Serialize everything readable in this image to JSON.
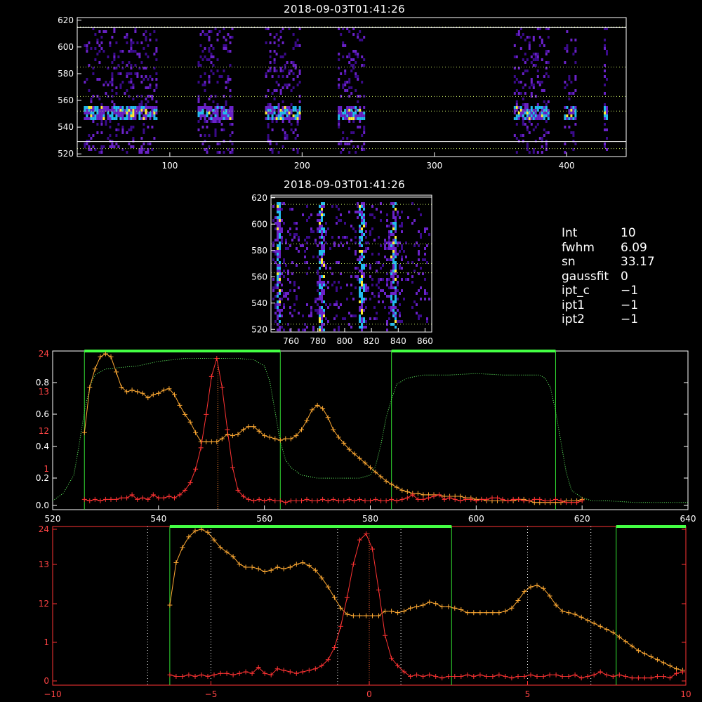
{
  "chart_data": [
    {
      "type": "heatmap",
      "title": "2018-09-03T01:41:26",
      "xlim": [
        30,
        445
      ],
      "ylim": [
        518,
        622
      ],
      "x_ticks": [
        "100",
        "200",
        "300",
        "400"
      ],
      "y_ticks": [
        "520",
        "540",
        "560",
        "580",
        "600",
        "620"
      ],
      "bands_x": [
        [
          35,
          90
        ],
        [
          121,
          148
        ],
        [
          172,
          198
        ],
        [
          227,
          247
        ],
        [
          360,
          386
        ],
        [
          398,
          406
        ],
        [
          428,
          431
        ]
      ],
      "core_y": 551,
      "guide_lines_y": [
        524,
        552,
        563,
        585,
        615
      ],
      "colors": {
        "low": "#3a0a8a",
        "mid": "#6a22c8",
        "high": "#22bbee",
        "peak": "#ffee33"
      }
    },
    {
      "type": "heatmap",
      "title": "2018-09-03T01:41:26",
      "xlim": [
        745,
        865
      ],
      "ylim": [
        518,
        622
      ],
      "x_ticks": [
        "760",
        "780",
        "800",
        "820",
        "840",
        "860"
      ],
      "y_ticks": [
        "520",
        "540",
        "560",
        "580",
        "600",
        "620"
      ],
      "streaks_x": [
        750,
        782,
        812,
        836
      ],
      "guide_lines_y": [
        524,
        563,
        570,
        585,
        615
      ]
    },
    {
      "type": "line",
      "xlim": [
        520,
        640
      ],
      "x_ticks": [
        "520",
        "540",
        "560",
        "580",
        "600",
        "620",
        "640"
      ],
      "left_ticks_white": [
        "0.0",
        "0.2",
        "0.4",
        "0.6",
        "0.8"
      ],
      "left_ticks_red": [
        "1",
        "12",
        "13",
        "24"
      ],
      "filter_windows": [
        [
          526,
          563
        ],
        [
          584,
          615
        ]
      ],
      "series": [
        {
          "color": "#ffaa33",
          "x": [
            526,
            527,
            528,
            529,
            530,
            531,
            532,
            533,
            534,
            535,
            536,
            537,
            538,
            539,
            540,
            541,
            542,
            543,
            544,
            545,
            546,
            547,
            548,
            549,
            550,
            551,
            552,
            553,
            554,
            555,
            556,
            557,
            558,
            559,
            560,
            561,
            562,
            563,
            564,
            565,
            566,
            567,
            568,
            569,
            570,
            571,
            572,
            573,
            574,
            575,
            576,
            577,
            578,
            579,
            580,
            581,
            582,
            583,
            584,
            585,
            586,
            587,
            588,
            589,
            590,
            591,
            592,
            593,
            594,
            595,
            596,
            597,
            598,
            599,
            600,
            601,
            602,
            603,
            604,
            605,
            606,
            607,
            608,
            609,
            610,
            611,
            612,
            613,
            614,
            615,
            616,
            617,
            618,
            619,
            620
          ],
          "y": [
            0.48,
            0.78,
            0.9,
            0.98,
            1.0,
            0.98,
            0.88,
            0.78,
            0.75,
            0.76,
            0.75,
            0.74,
            0.71,
            0.73,
            0.74,
            0.76,
            0.77,
            0.73,
            0.66,
            0.6,
            0.55,
            0.48,
            0.42,
            0.42,
            0.42,
            0.42,
            0.44,
            0.47,
            0.46,
            0.47,
            0.5,
            0.52,
            0.52,
            0.49,
            0.46,
            0.45,
            0.44,
            0.43,
            0.44,
            0.44,
            0.46,
            0.5,
            0.56,
            0.63,
            0.66,
            0.64,
            0.58,
            0.5,
            0.45,
            0.41,
            0.37,
            0.34,
            0.31,
            0.28,
            0.25,
            0.22,
            0.19,
            0.16,
            0.14,
            0.12,
            0.1,
            0.09,
            0.08,
            0.08,
            0.07,
            0.07,
            0.07,
            0.07,
            0.06,
            0.06,
            0.06,
            0.06,
            0.05,
            0.05,
            0.04,
            0.04,
            0.03,
            0.03,
            0.03,
            0.03,
            0.03,
            0.03,
            0.04,
            0.04,
            0.03,
            0.02,
            0.02,
            0.02,
            0.02,
            0.02,
            0.02,
            0.03,
            0.03,
            0.03,
            0.04
          ]
        },
        {
          "color": "#ff3333",
          "x": [
            526,
            527,
            528,
            529,
            530,
            531,
            532,
            533,
            534,
            535,
            536,
            537,
            538,
            539,
            540,
            541,
            542,
            543,
            544,
            545,
            546,
            547,
            548,
            549,
            550,
            551,
            552,
            553,
            554,
            555,
            556,
            557,
            558,
            559,
            560,
            561,
            562,
            563,
            564,
            565,
            566,
            567,
            568,
            569,
            570,
            571,
            572,
            573,
            574,
            575,
            576,
            577,
            578,
            579,
            580,
            581,
            582,
            583,
            584,
            585,
            586,
            587,
            588,
            589,
            590,
            591,
            592,
            593,
            594,
            595,
            596,
            597,
            598,
            599,
            600,
            601,
            602,
            603,
            604,
            605,
            606,
            607,
            608,
            609,
            610,
            611,
            612,
            613,
            614,
            615,
            616,
            617,
            618,
            619,
            620
          ],
          "y": [
            0.04,
            0.03,
            0.04,
            0.03,
            0.04,
            0.04,
            0.04,
            0.05,
            0.05,
            0.07,
            0.04,
            0.05,
            0.04,
            0.07,
            0.05,
            0.05,
            0.06,
            0.05,
            0.07,
            0.1,
            0.15,
            0.24,
            0.38,
            0.6,
            0.85,
            0.97,
            0.78,
            0.5,
            0.25,
            0.1,
            0.06,
            0.04,
            0.03,
            0.04,
            0.03,
            0.04,
            0.03,
            0.03,
            0.02,
            0.03,
            0.03,
            0.03,
            0.04,
            0.03,
            0.03,
            0.04,
            0.03,
            0.04,
            0.03,
            0.03,
            0.04,
            0.03,
            0.04,
            0.03,
            0.03,
            0.04,
            0.03,
            0.03,
            0.04,
            0.03,
            0.04,
            0.05,
            0.07,
            0.04,
            0.04,
            0.05,
            0.06,
            0.07,
            0.04,
            0.05,
            0.04,
            0.03,
            0.04,
            0.04,
            0.03,
            0.04,
            0.04,
            0.05,
            0.05,
            0.04,
            0.03,
            0.04,
            0.04,
            0.03,
            0.03,
            0.04,
            0.04,
            0.03,
            0.03,
            0.04,
            0.03,
            0.02,
            0.02,
            0.02,
            0.03
          ]
        },
        {
          "color": "#66ff66",
          "style": "dotted",
          "x": [
            520,
            522,
            524,
            525,
            526,
            527,
            528,
            530,
            533,
            536,
            540,
            545,
            550,
            555,
            558,
            560,
            561,
            562,
            563,
            564,
            565,
            567,
            570,
            575,
            578,
            580,
            581,
            582,
            583,
            584,
            585,
            587,
            590,
            595,
            600,
            605,
            610,
            612,
            613,
            614,
            615,
            616,
            617,
            618,
            620,
            622,
            625,
            630,
            635,
            640
          ],
          "y": [
            0.03,
            0.08,
            0.2,
            0.4,
            0.62,
            0.78,
            0.86,
            0.9,
            0.91,
            0.92,
            0.95,
            0.97,
            0.97,
            0.97,
            0.96,
            0.92,
            0.82,
            0.62,
            0.42,
            0.3,
            0.25,
            0.2,
            0.18,
            0.18,
            0.18,
            0.2,
            0.26,
            0.4,
            0.58,
            0.7,
            0.8,
            0.84,
            0.86,
            0.86,
            0.87,
            0.86,
            0.86,
            0.86,
            0.84,
            0.78,
            0.62,
            0.42,
            0.22,
            0.1,
            0.05,
            0.03,
            0.03,
            0.02,
            0.02,
            0.02
          ]
        }
      ]
    },
    {
      "type": "line",
      "xlim": [
        -10,
        10
      ],
      "x_ticks": [
        "-10",
        "-5",
        "0",
        "5",
        "10"
      ],
      "left_ticks_red": [
        "0",
        "1",
        "12",
        "13",
        "24"
      ],
      "filter_windows": [
        [
          -6.3,
          2.6
        ],
        [
          7.8,
          10
        ]
      ],
      "vlines_x": [
        -7.0,
        -5.0,
        -1.0,
        1.0,
        5.0,
        7.0
      ],
      "series": [
        {
          "color": "#ffaa33",
          "x": [
            -6.3,
            -6.1,
            -5.9,
            -5.7,
            -5.5,
            -5.3,
            -5.1,
            -4.9,
            -4.7,
            -4.5,
            -4.3,
            -4.1,
            -3.9,
            -3.7,
            -3.5,
            -3.3,
            -3.1,
            -2.9,
            -2.7,
            -2.5,
            -2.3,
            -2.1,
            -1.9,
            -1.7,
            -1.5,
            -1.3,
            -1.1,
            -0.9,
            -0.7,
            -0.5,
            -0.3,
            -0.1,
            0.1,
            0.3,
            0.5,
            0.7,
            0.9,
            1.1,
            1.3,
            1.5,
            1.7,
            1.9,
            2.1,
            2.3,
            2.5,
            2.7,
            2.9,
            3.1,
            3.3,
            3.5,
            3.7,
            3.9,
            4.1,
            4.3,
            4.5,
            4.7,
            4.9,
            5.1,
            5.3,
            5.5,
            5.7,
            5.9,
            6.1,
            6.3,
            6.5,
            6.7,
            6.9,
            7.1,
            7.3,
            7.5,
            7.7,
            7.9,
            8.1,
            8.3,
            8.5,
            8.7,
            8.9,
            9.1,
            9.3,
            9.5,
            9.7,
            9.9
          ],
          "y": [
            0.5,
            0.78,
            0.88,
            0.95,
            0.99,
            1.0,
            0.98,
            0.93,
            0.88,
            0.85,
            0.82,
            0.77,
            0.75,
            0.75,
            0.74,
            0.72,
            0.73,
            0.75,
            0.74,
            0.75,
            0.77,
            0.78,
            0.76,
            0.73,
            0.68,
            0.62,
            0.55,
            0.48,
            0.44,
            0.43,
            0.43,
            0.43,
            0.43,
            0.43,
            0.46,
            0.46,
            0.45,
            0.46,
            0.48,
            0.49,
            0.5,
            0.52,
            0.51,
            0.49,
            0.49,
            0.48,
            0.47,
            0.45,
            0.45,
            0.45,
            0.45,
            0.45,
            0.45,
            0.46,
            0.48,
            0.53,
            0.59,
            0.62,
            0.63,
            0.61,
            0.56,
            0.5,
            0.46,
            0.45,
            0.44,
            0.42,
            0.4,
            0.38,
            0.36,
            0.34,
            0.32,
            0.29,
            0.26,
            0.23,
            0.2,
            0.18,
            0.16,
            0.14,
            0.12,
            0.1,
            0.08,
            0.07
          ]
        },
        {
          "color": "#ff3333",
          "x": [
            -6.3,
            -6.1,
            -5.9,
            -5.7,
            -5.5,
            -5.3,
            -5.1,
            -4.9,
            -4.7,
            -4.5,
            -4.3,
            -4.1,
            -3.9,
            -3.7,
            -3.5,
            -3.3,
            -3.1,
            -2.9,
            -2.7,
            -2.5,
            -2.3,
            -2.1,
            -1.9,
            -1.7,
            -1.5,
            -1.3,
            -1.1,
            -0.9,
            -0.7,
            -0.5,
            -0.3,
            -0.1,
            0.1,
            0.3,
            0.5,
            0.7,
            0.9,
            1.1,
            1.3,
            1.5,
            1.7,
            1.9,
            2.1,
            2.3,
            2.5,
            2.7,
            2.9,
            3.1,
            3.3,
            3.5,
            3.7,
            3.9,
            4.1,
            4.3,
            4.5,
            4.7,
            4.9,
            5.1,
            5.3,
            5.5,
            5.7,
            5.9,
            6.1,
            6.3,
            6.5,
            6.7,
            6.9,
            7.1,
            7.3,
            7.5,
            7.7,
            7.9,
            8.1,
            8.3,
            8.5,
            8.7,
            8.9,
            9.1,
            9.3,
            9.5,
            9.7,
            9.9
          ],
          "y": [
            0.04,
            0.03,
            0.03,
            0.04,
            0.03,
            0.04,
            0.03,
            0.04,
            0.05,
            0.05,
            0.04,
            0.05,
            0.06,
            0.05,
            0.09,
            0.05,
            0.04,
            0.08,
            0.07,
            0.06,
            0.05,
            0.06,
            0.07,
            0.08,
            0.1,
            0.14,
            0.22,
            0.36,
            0.55,
            0.77,
            0.93,
            0.97,
            0.87,
            0.6,
            0.3,
            0.15,
            0.1,
            0.06,
            0.03,
            0.04,
            0.03,
            0.04,
            0.03,
            0.02,
            0.03,
            0.03,
            0.03,
            0.04,
            0.03,
            0.04,
            0.03,
            0.03,
            0.04,
            0.03,
            0.02,
            0.03,
            0.03,
            0.04,
            0.03,
            0.03,
            0.04,
            0.04,
            0.03,
            0.03,
            0.04,
            0.02,
            0.03,
            0.04,
            0.06,
            0.04,
            0.03,
            0.04,
            0.03,
            0.02,
            0.02,
            0.02,
            0.02,
            0.03,
            0.03,
            0.02,
            0.05,
            0.06
          ]
        }
      ]
    }
  ],
  "params": [
    {
      "key": "Int",
      "value": "10"
    },
    {
      "key": "fwhm",
      "value": "6.09"
    },
    {
      "key": "sn",
      "value": "33.17"
    },
    {
      "key": "gaussfit",
      "value": "0"
    },
    {
      "key": "ipt_c",
      "value": "−1"
    },
    {
      "key": "ipt1",
      "value": "−1"
    },
    {
      "key": "ipt2",
      "value": "−1"
    }
  ]
}
